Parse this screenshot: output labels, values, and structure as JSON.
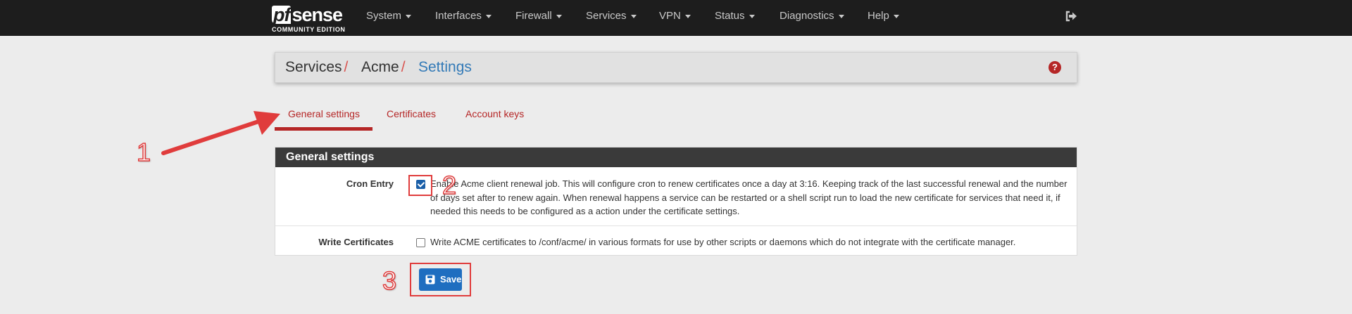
{
  "navbar": {
    "logo_text": "sense",
    "logo_prefix": "pf",
    "logo_edition": "COMMUNITY EDITION",
    "items": [
      {
        "label": "System"
      },
      {
        "label": "Interfaces"
      },
      {
        "label": "Firewall"
      },
      {
        "label": "Services"
      },
      {
        "label": "VPN"
      },
      {
        "label": "Status"
      },
      {
        "label": "Diagnostics"
      },
      {
        "label": "Help"
      }
    ],
    "logout_icon": "sign-out-icon"
  },
  "breadcrumb": {
    "items": [
      "Services",
      "Acme",
      "Settings"
    ],
    "separator": "/",
    "help_icon": "question-circle-icon",
    "help_glyph": "?"
  },
  "tabs": [
    {
      "label": "General settings",
      "active": true
    },
    {
      "label": "Certificates",
      "active": false
    },
    {
      "label": "Account keys",
      "active": false
    }
  ],
  "panel": {
    "heading": "General settings",
    "fields": [
      {
        "label": "Cron Entry",
        "checked": true,
        "description": "Enable Acme client renewal job. This will configure cron to renew certificates once a day at 3:16. Keeping track of the last successful renewal and the number of days set after to renew again. When renewal happens a service can be restarted or a shell script run to load the new certificate for services that need it, if needed this needs to be configured as a action under the certificate settings."
      },
      {
        "label": "Write Certificates",
        "checked": false,
        "description": "Write ACME certificates to /conf/acme/ in various formats for use by other scripts or daemons which do not integrate with the certificate manager."
      }
    ]
  },
  "save_button": {
    "label": "Save",
    "icon": "save-icon"
  },
  "annotations": [
    "1",
    "2",
    "3"
  ],
  "colors": {
    "navbar_bg": "#1d1d1d",
    "accent_red": "#b52626",
    "link_blue": "#337ab7",
    "button_blue": "#1f6ec0",
    "annotation_red": "#e03c3c"
  }
}
